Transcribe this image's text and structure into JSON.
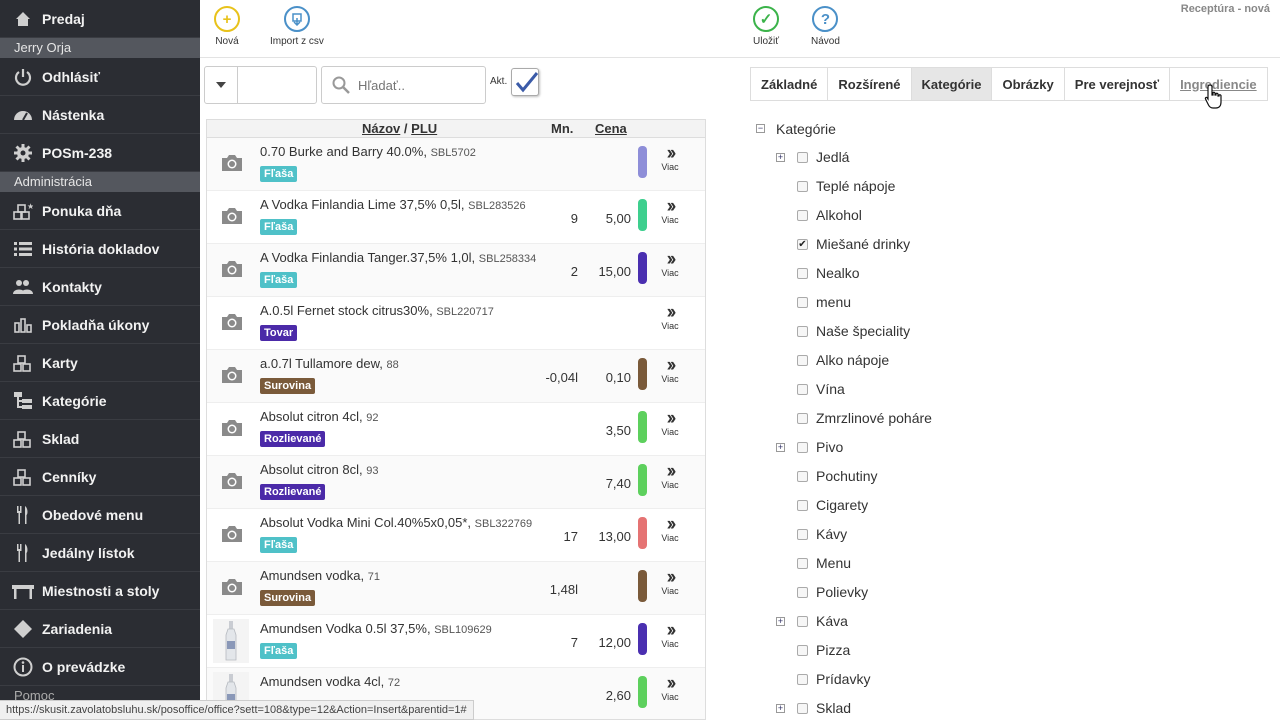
{
  "window_title": "Receptúra - nová",
  "sidebar": {
    "top_item": {
      "label": "Predaj",
      "icon": "home-icon"
    },
    "user_section": "Jerry Orja",
    "user_items": [
      {
        "label": "Odhlásiť",
        "icon": "power-icon"
      },
      {
        "label": "Nástenka",
        "icon": "dashboard-icon"
      },
      {
        "label": "POSm-238",
        "icon": "gear-icon"
      }
    ],
    "admin_section": "Administrácia",
    "admin_items": [
      {
        "label": "Ponuka dňa",
        "icon": "boxes-star-icon"
      },
      {
        "label": "História dokladov",
        "icon": "list-icon"
      },
      {
        "label": "Kontakty",
        "icon": "users-icon"
      },
      {
        "label": "Pokladňa úkony",
        "icon": "bar-chart-icon"
      },
      {
        "label": "Karty",
        "icon": "boxes-icon"
      },
      {
        "label": "Kategórie",
        "icon": "tree-icon"
      },
      {
        "label": "Sklad",
        "icon": "boxes-icon"
      },
      {
        "label": "Cenníky",
        "icon": "boxes-icon"
      },
      {
        "label": "Obedové menu",
        "icon": "cutlery-icon"
      },
      {
        "label": "Jedálny lístok",
        "icon": "cutlery-icon"
      },
      {
        "label": "Miestnosti a stoly",
        "icon": "table-icon"
      },
      {
        "label": "Zariadenia",
        "icon": "diamond-icon"
      },
      {
        "label": "O prevádzke",
        "icon": "info-icon"
      }
    ],
    "bottom_partial": "Pomoc"
  },
  "toolbar": {
    "new_label": "Nová",
    "import_label": "Import z csv",
    "save_label": "Uložiť",
    "help_label": "Návod"
  },
  "filter": {
    "search_placeholder": "Hľadať..",
    "active_label": "Akt."
  },
  "list": {
    "header_name": "Názov",
    "header_sep": "/",
    "header_plu": "PLU",
    "header_qty": "Mn.",
    "header_price": "Cena",
    "more_label": "Viac",
    "rows": [
      {
        "name": "0.70 Burke and Barry 40.0%,",
        "plu": "SBL5702",
        "badge": "Fľaša",
        "badge_color": "#4fc1c8",
        "qty": "",
        "price": "",
        "color": "#8e8ed8",
        "thumb": "camera"
      },
      {
        "name": "A Vodka Finlandia Lime 37,5% 0,5l,",
        "plu": "SBL283526",
        "badge": "Fľaša",
        "badge_color": "#4fc1c8",
        "qty": "9",
        "price": "5,00",
        "color": "#3ecf8e",
        "thumb": "camera"
      },
      {
        "name": "A Vodka Finlandia Tanger.37,5% 1,0l,",
        "plu": "SBL258334",
        "badge": "Fľaša",
        "badge_color": "#4fc1c8",
        "qty": "2",
        "price": "15,00",
        "color": "#4a2fb0",
        "thumb": "camera"
      },
      {
        "name": "A.0.5l Fernet stock citrus30%,",
        "plu": "SBL220717",
        "badge": "Tovar",
        "badge_color": "#4b2aa8",
        "qty": "",
        "price": "",
        "color": "",
        "thumb": "camera"
      },
      {
        "name": "a.0.7l Tullamore dew,",
        "plu": "88",
        "badge": "Surovina",
        "badge_color": "#7a5a3a",
        "qty": "-0,04l",
        "price": "0,10",
        "color": "#7a5a3a",
        "thumb": "camera"
      },
      {
        "name": "Absolut citron 4cl,",
        "plu": "92",
        "badge": "Rozlievané",
        "badge_color": "#4b2aa8",
        "qty": "",
        "price": "3,50",
        "color": "#5dd05d",
        "thumb": "camera"
      },
      {
        "name": "Absolut citron 8cl,",
        "plu": "93",
        "badge": "Rozlievané",
        "badge_color": "#4b2aa8",
        "qty": "",
        "price": "7,40",
        "color": "#5dd05d",
        "thumb": "camera"
      },
      {
        "name": "Absolut Vodka Mini Col.40%5x0,05*,",
        "plu": "SBL322769",
        "badge": "Fľaša",
        "badge_color": "#4fc1c8",
        "qty": "17",
        "price": "13,00",
        "color": "#e57373",
        "thumb": "camera"
      },
      {
        "name": "Amundsen vodka,",
        "plu": "71",
        "badge": "Surovina",
        "badge_color": "#7a5a3a",
        "qty": "1,48l",
        "price": "",
        "color": "#7a5a3a",
        "thumb": "camera"
      },
      {
        "name": "Amundsen Vodka 0.5l 37,5%,",
        "plu": "SBL109629",
        "badge": "Fľaša",
        "badge_color": "#4fc1c8",
        "qty": "7",
        "price": "12,00",
        "color": "#4a2fb0",
        "thumb": "bottle"
      },
      {
        "name": "Amundsen vodka 4cl,",
        "plu": "72",
        "badge": "",
        "badge_color": "",
        "qty": "",
        "price": "2,60",
        "color": "#5dd05d",
        "thumb": "bottle"
      }
    ]
  },
  "tabs": [
    {
      "label": "Základné",
      "state": "normal"
    },
    {
      "label": "Rozšírené",
      "state": "normal"
    },
    {
      "label": "Kategórie",
      "state": "active"
    },
    {
      "label": "Obrázky",
      "state": "normal"
    },
    {
      "label": "Pre verejnosť",
      "state": "normal"
    },
    {
      "label": "Ingrediencie",
      "state": "hover"
    }
  ],
  "categories": {
    "root": "Kategórie",
    "items": [
      {
        "label": "Jedlá",
        "expandable": true,
        "checked": false
      },
      {
        "label": "Teplé nápoje",
        "expandable": false,
        "checked": false
      },
      {
        "label": "Alkohol",
        "expandable": false,
        "checked": false
      },
      {
        "label": "Miešané drinky",
        "expandable": false,
        "checked": true
      },
      {
        "label": "Nealko",
        "expandable": false,
        "checked": false
      },
      {
        "label": "menu",
        "expandable": false,
        "checked": false
      },
      {
        "label": "Naše špeciality",
        "expandable": false,
        "checked": false
      },
      {
        "label": "Alko nápoje",
        "expandable": false,
        "checked": false
      },
      {
        "label": "Vína",
        "expandable": false,
        "checked": false
      },
      {
        "label": "Zmrzlinové poháre",
        "expandable": false,
        "checked": false
      },
      {
        "label": "Pivo",
        "expandable": true,
        "checked": false
      },
      {
        "label": "Pochutiny",
        "expandable": false,
        "checked": false
      },
      {
        "label": "Cigarety",
        "expandable": false,
        "checked": false
      },
      {
        "label": "Kávy",
        "expandable": false,
        "checked": false
      },
      {
        "label": "Menu",
        "expandable": false,
        "checked": false
      },
      {
        "label": "Polievky",
        "expandable": false,
        "checked": false
      },
      {
        "label": "Káva",
        "expandable": true,
        "checked": false
      },
      {
        "label": "Pizza",
        "expandable": false,
        "checked": false
      },
      {
        "label": "Prídavky",
        "expandable": false,
        "checked": false
      },
      {
        "label": "Sklad",
        "expandable": true,
        "checked": false
      }
    ]
  },
  "statusbar": "https://skusit.zavolatobsluhu.sk/posoffice/office?sett=108&type=12&Action=Insert&parentid=1#",
  "colors": {
    "sidebar_bg": "#2b2d33",
    "new_icon": "#e8c21a",
    "import_icon": "#4a90c8",
    "save_icon": "#3bb34a",
    "help_icon": "#4a90c8"
  }
}
